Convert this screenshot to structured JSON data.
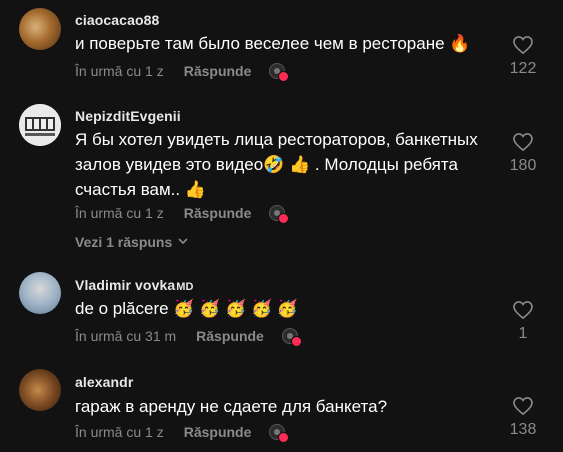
{
  "comments": [
    {
      "author": "ciaocacao88",
      "text": "и поверьте там было веселее чем в ресторане 🔥",
      "time": "În urmă cu 1 z",
      "reply_label": "Răspunde",
      "likes": "122",
      "avatar_color": "#8a5a2b"
    },
    {
      "author": "NepizditEvgenii",
      "text": "Я бы хотел увидеть лица рестораторов, банкетных залов увидев это видео🤣 👍 . Молодцы ребята счастья вам.. 👍",
      "time": "În urmă cu 1 z",
      "reply_label": "Răspunde",
      "likes": "180",
      "view_replies": "Vezi 1 răspuns",
      "avatar_color": "#cfcfcf"
    },
    {
      "author": "Vladimir vovka",
      "author_badge": "MD",
      "text": "de o plăcere 🥳 🥳 🥳 🥳 🥳",
      "time": "În urmă cu 31 m",
      "reply_label": "Răspunde",
      "likes": "1",
      "avatar_color": "#7f98b0"
    },
    {
      "author": "alexandr",
      "text": "гараж в аренду не сдаете для банкета?",
      "time": "În urmă cu 1 z",
      "reply_label": "Răspunde",
      "likes": "138",
      "avatar_color": "#6b4a2a"
    }
  ],
  "colors": {
    "background": "#121212",
    "muted": "#8a8a8a",
    "accent": "#fe2c55"
  }
}
